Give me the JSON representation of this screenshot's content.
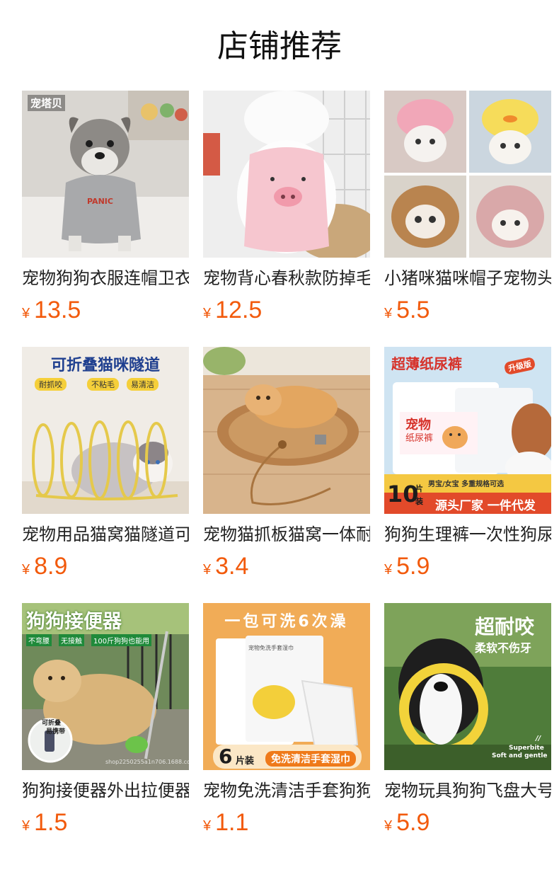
{
  "title": "店铺推荐",
  "currency": "¥",
  "products": [
    {
      "name": "宠物狗狗衣服连帽卫衣",
      "price": "13.5",
      "image": {
        "badge": "宠塔贝",
        "shirt_text": "PANIC"
      }
    },
    {
      "name": "宠物背心春秋款防掉毛",
      "price": "12.5",
      "image": {}
    },
    {
      "name": "小猪咪猫咪帽子宠物头套",
      "price": "5.5",
      "image": {}
    },
    {
      "name": "宠物用品猫窝猫隧道可折叠",
      "price": "8.9",
      "image": {
        "headline": "可折叠猫咪隧道",
        "tags": [
          "耐抓咬",
          "不粘毛",
          "易清洁"
        ]
      }
    },
    {
      "name": "宠物猫抓板猫窝一体耐磨",
      "price": "3.4",
      "image": {}
    },
    {
      "name": "狗狗生理裤一次性狗尿裤",
      "price": "5.9",
      "image": {
        "headline": "超薄纸尿裤",
        "badge": "升级版",
        "pack_title": "宠物",
        "pack_subtitle": "纸尿裤",
        "info": "男宝/女宝  多重规格可选",
        "count": "10",
        "count_unit_top": "片",
        "count_unit_bottom": "装",
        "slogan": "源头厂家 一件代发"
      }
    },
    {
      "name": "狗狗接便器外出拉便器",
      "price": "1.5",
      "image": {
        "headline": "狗狗接便器",
        "tags": [
          "不弯腰",
          "无接触",
          "100斤狗狗也能用"
        ],
        "note_line1": "可折叠",
        "note_line2": "易携带",
        "watermark": "shop2250255a1n706.1688.com"
      }
    },
    {
      "name": "宠物免洗清洁手套狗狗湿巾",
      "price": "1.1",
      "image": {
        "headline": "一包可洗6次澡",
        "pack_label": "宠物免洗手套湿巾",
        "pack_count": "6",
        "pack_unit": "片装",
        "slogan": "免洗清洁手套湿巾"
      }
    },
    {
      "name": "宠物玩具狗狗飞盘大号耐咬",
      "price": "5.9",
      "image": {
        "headline": "超耐咬",
        "subline": "柔软不伤牙",
        "mark": "//",
        "brand_line1": "Superbite",
        "brand_line2": "Soft and gentle"
      }
    }
  ]
}
